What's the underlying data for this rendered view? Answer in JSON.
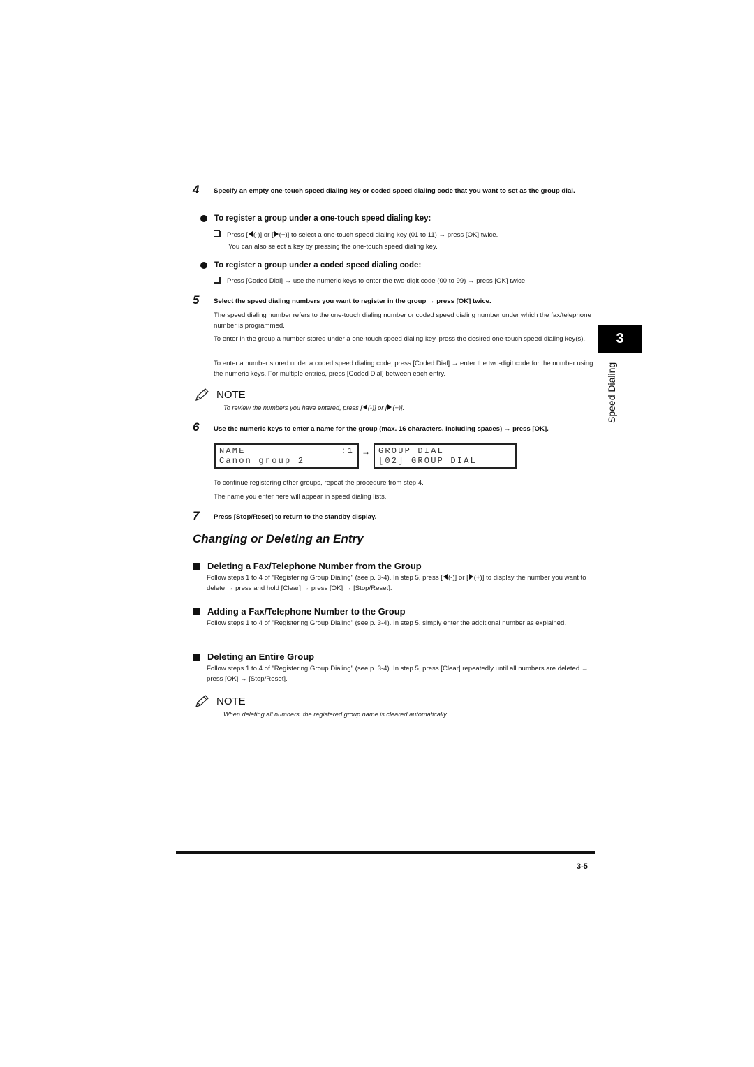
{
  "steps": {
    "s4": {
      "num": "4",
      "title": "Specify an empty one-touch speed dialing key or coded speed dialing code that you want to set as the group dial.",
      "options": [
        {
          "heading": "To register a group under a one-touch speed dialing key:",
          "item_parts": [
            "Press [",
            "(-)] or [",
            "(+)] to select a one-touch speed dialing key (01 to 11) → press [OK] twice."
          ],
          "item_extra": "You can also select a key by pressing the one-touch speed dialing key."
        },
        {
          "heading": "To register a group under a coded speed dialing code:",
          "item": "Press [Coded Dial] → use the numeric keys to enter the two-digit code (00 to 99) → press [OK] twice."
        }
      ]
    },
    "s5": {
      "num": "5",
      "title": "Select the speed dialing numbers you want to register in the group → press [OK] twice.",
      "paragraphs": [
        "The speed dialing number refers to the one-touch dialing number or coded speed dialing number under which the fax/telephone number is programmed.",
        "To enter in the group a number stored under a one-touch speed dialing key, press the desired one-touch speed dialing key(s).",
        "To enter a number stored under a coded speed dialing code, press [Coded Dial] → enter the two-digit code for the number using the numeric keys. For multiple entries, press [Coded Dial] between each entry."
      ],
      "note": {
        "label": "NOTE",
        "text_parts": [
          "To review the numbers you have entered, press [",
          "(-)] or [",
          "(+)]."
        ]
      }
    },
    "s6": {
      "num": "6",
      "title": "Use the numeric keys to enter a name for the group (max. 16 characters, including spaces) → press [OK].",
      "lcd_left": {
        "line1_label": "NAME",
        "line1_value": ":1",
        "line2_prefix": "Canon group ",
        "line2_cursor": "2"
      },
      "arrow": "→",
      "lcd_right": {
        "line1": "GROUP DIAL",
        "line2": "[02] GROUP DIAL"
      },
      "paragraphs": [
        "To continue registering other groups, repeat the procedure from step 4.",
        "The name you enter here will appear in speed dialing lists."
      ]
    },
    "s7": {
      "num": "7",
      "title": "Press [Stop/Reset] to return to the standby display."
    }
  },
  "section": {
    "title": "Changing or Deleting an Entry",
    "subsections": [
      {
        "heading": "Deleting a Fax/Telephone Number from the Group",
        "body_parts": [
          "Follow steps 1 to 4 of \"Registering Group Dialing\" (see p. 3-4). In step 5, press [",
          "(-)] or [",
          "(+)] to display the number you want to delete → press and hold [Clear] → press [OK] → [Stop/Reset]."
        ]
      },
      {
        "heading": "Adding a Fax/Telephone Number to the Group",
        "body": "Follow steps 1 to 4 of \"Registering Group Dialing\" (see p. 3-4). In step 5, simply enter the additional number as explained."
      },
      {
        "heading": "Deleting an Entire Group",
        "body": "Follow steps 1 to 4 of \"Registering Group Dialing\" (see p. 3-4). In step 5, press [Clear] repeatedly until all numbers are deleted → press [OK] → [Stop/Reset]."
      }
    ],
    "note": {
      "label": "NOTE",
      "text": "When deleting all numbers, the registered group name is cleared automatically."
    }
  },
  "sidebar": {
    "chapter_number": "3",
    "chapter_title": "Speed Dialing"
  },
  "footer": {
    "page_number": "3-5"
  }
}
